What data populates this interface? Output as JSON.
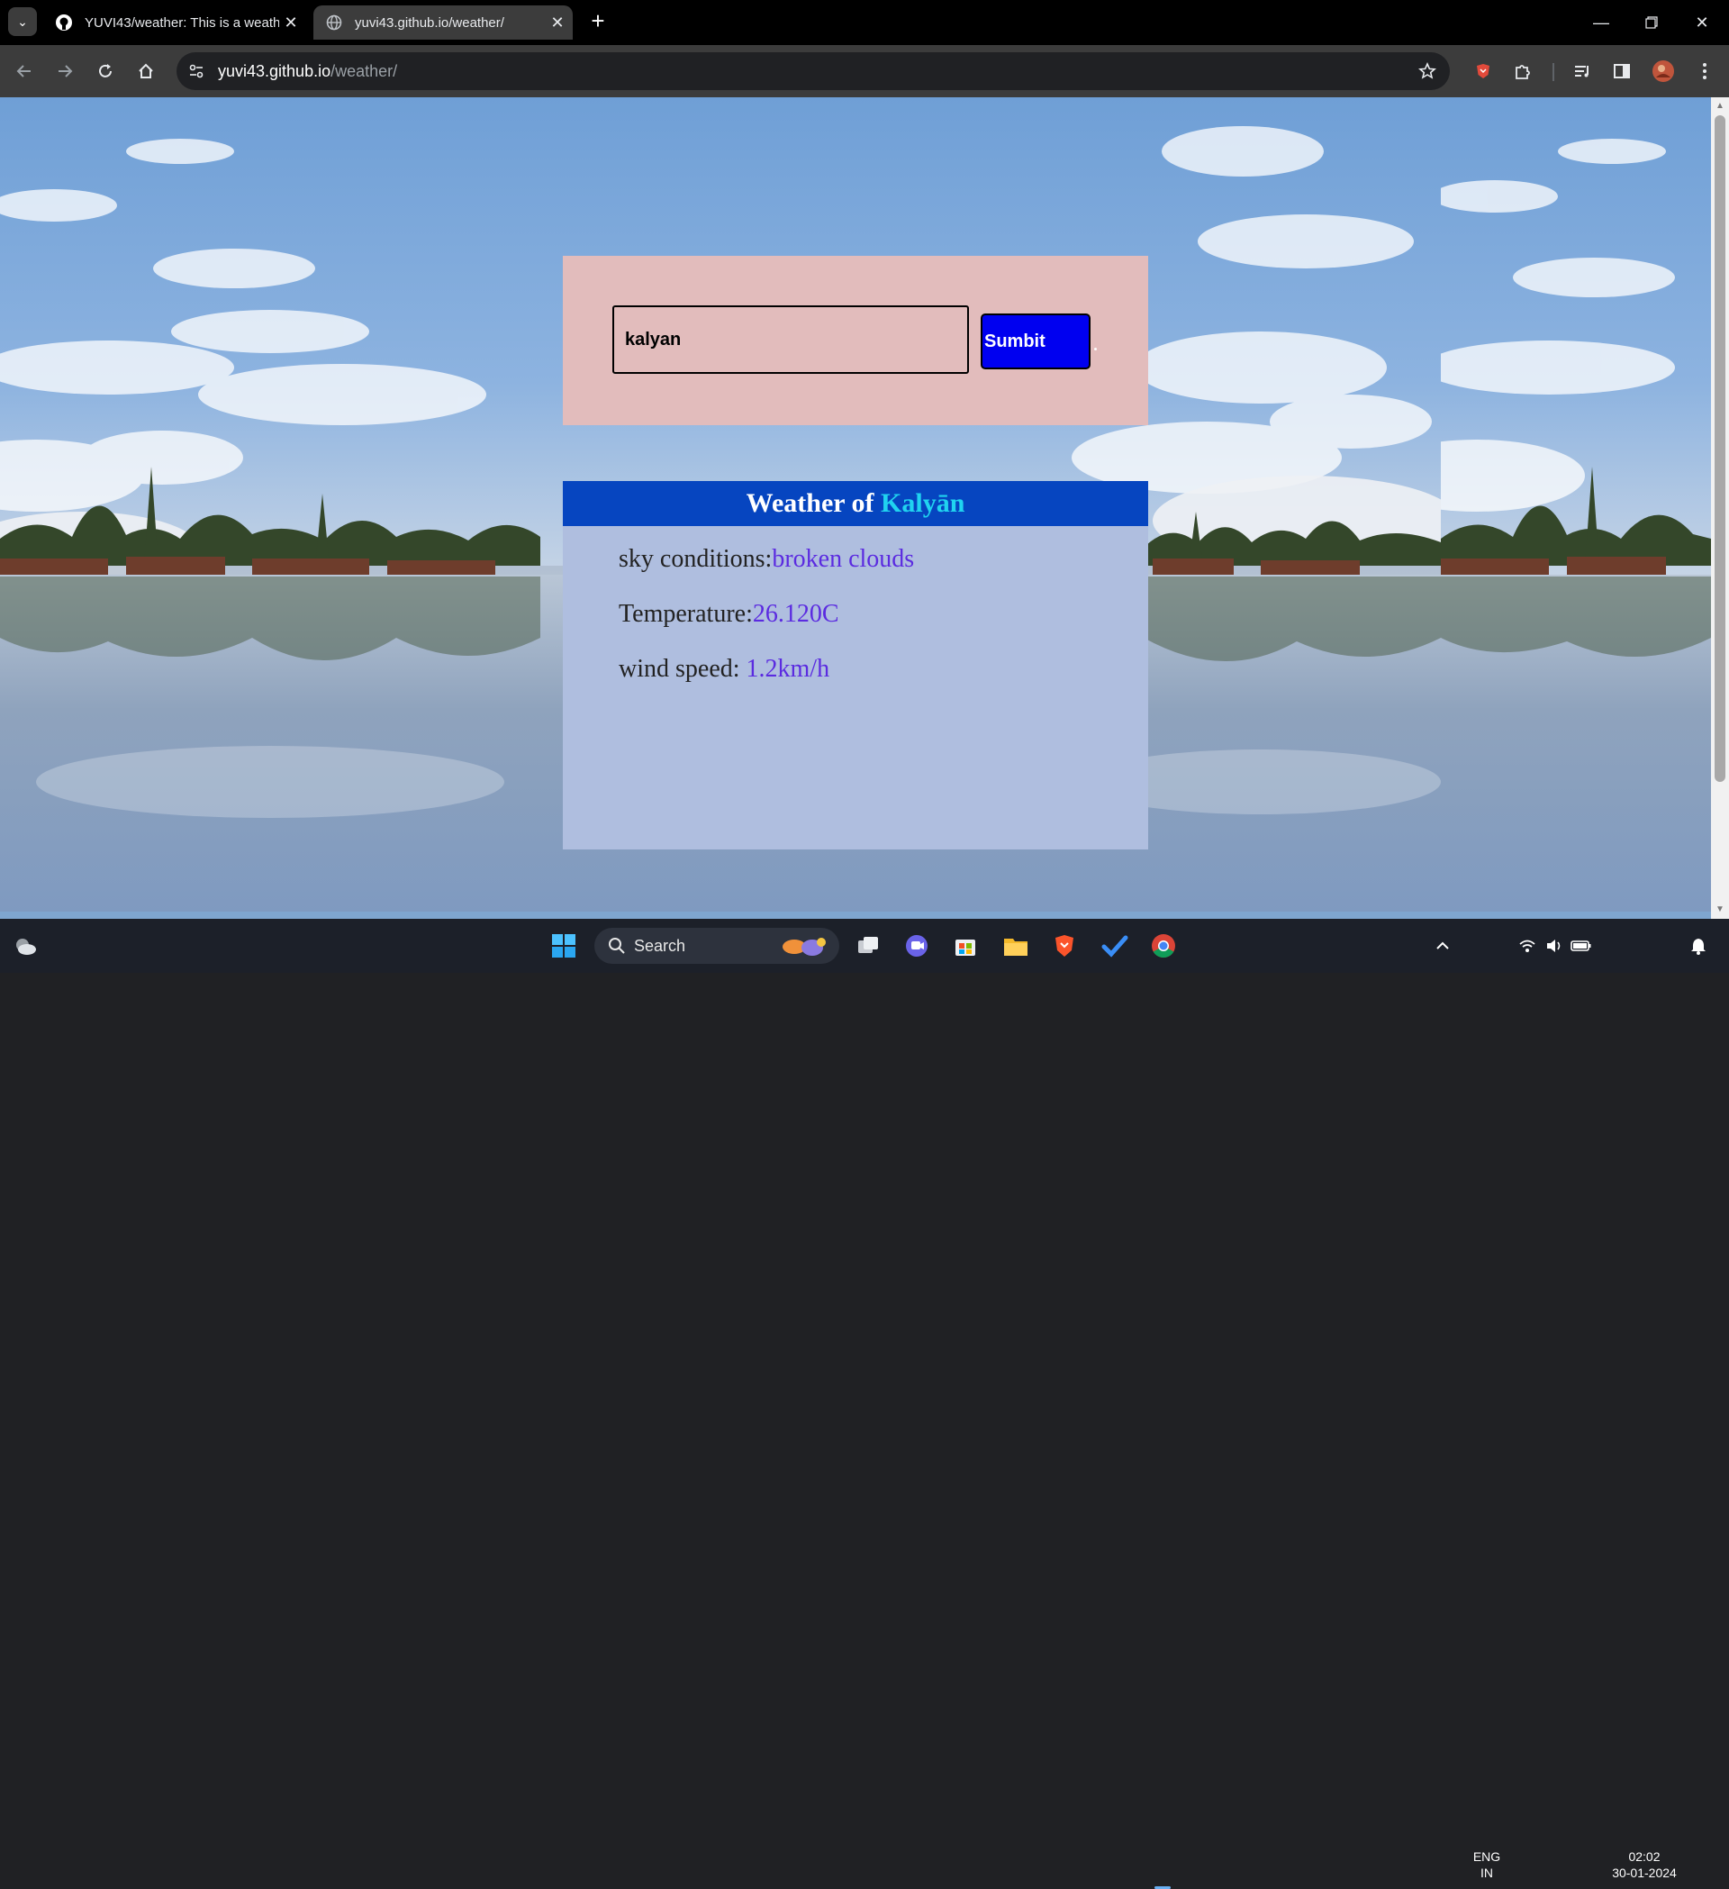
{
  "browser": {
    "tabs": [
      {
        "title": "YUVI43/weather: This is a weath",
        "favicon": "github-icon",
        "active": false
      },
      {
        "title": "yuvi43.github.io/weather/",
        "favicon": "globe-icon",
        "active": true
      }
    ],
    "address": {
      "host": "yuvi43.github.io",
      "path": "/weather/"
    }
  },
  "app": {
    "search": {
      "value": "kalyan",
      "button_label": "Sumbit"
    },
    "weather": {
      "heading_prefix": "Weather of ",
      "city": "Kalyān",
      "sky_label": "sky conditions:",
      "sky_value": "broken clouds",
      "temp_label": "Temperature:",
      "temp_value": "26.120C",
      "wind_label": "wind speed: ",
      "wind_value": "1.2km/h"
    }
  },
  "taskbar": {
    "search_label": "Search",
    "language": {
      "line1": "ENG",
      "line2": "IN"
    },
    "time": "02:02",
    "date": "30-01-2024"
  },
  "colors": {
    "search_panel_bg": "#e2bcbc",
    "weather_panel_bg": "#afbedf",
    "weather_header_bg": "#0645c0",
    "city_highlight": "#20d3f0",
    "value_text": "#5b2be0",
    "submit_bg": "#0000f0"
  }
}
